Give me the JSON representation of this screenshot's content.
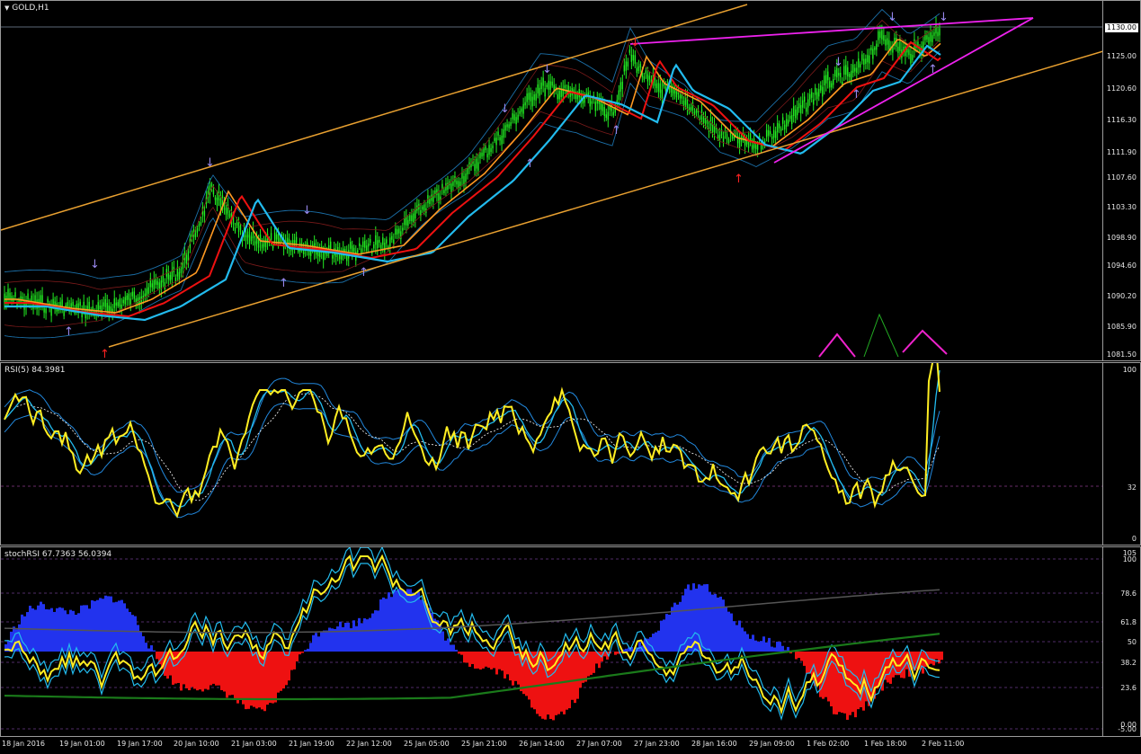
{
  "main": {
    "label": "GOLD,H1",
    "price_ticks": [
      "1130.00",
      "1125.00",
      "1120.60",
      "1116.30",
      "1111.90",
      "1107.60",
      "1103.30",
      "1098.90",
      "1094.60",
      "1090.20",
      "1085.90",
      "1081.50"
    ],
    "current_price": "1130.00"
  },
  "rsi": {
    "label": "RSI(5) 84.3981",
    "ticks": [
      "100",
      "32",
      "0"
    ]
  },
  "stoch": {
    "label": "stochRSI 67.7363 56.0394",
    "ticks": [
      "105",
      "100",
      "78.6",
      "61.8",
      "50",
      "38.2",
      "23.6",
      "0.00",
      "-5.00"
    ]
  },
  "time_axis": [
    "18 Jan 2016",
    "19 Jan 01:00",
    "19 Jan 17:00",
    "20 Jan 10:00",
    "21 Jan 03:00",
    "21 Jan 19:00",
    "22 Jan 12:00",
    "25 Jan 05:00",
    "25 Jan 21:00",
    "26 Jan 14:00",
    "27 Jan 07:00",
    "27 Jan 23:00",
    "28 Jan 16:00",
    "29 Jan 09:00",
    "1 Feb 02:00",
    "1 Feb 18:00",
    "2 Feb 11:00"
  ],
  "colors": {
    "candle": "#22ee22",
    "ema_fast": "#ff9922",
    "ema_mid": "#ee1111",
    "ema_slow": "#22bbee",
    "channel": "#e8a030",
    "wedge": "#ee22ee",
    "rsi": "#ffee22",
    "bars_up": "#2233ee",
    "bars_down": "#ee1111"
  }
}
